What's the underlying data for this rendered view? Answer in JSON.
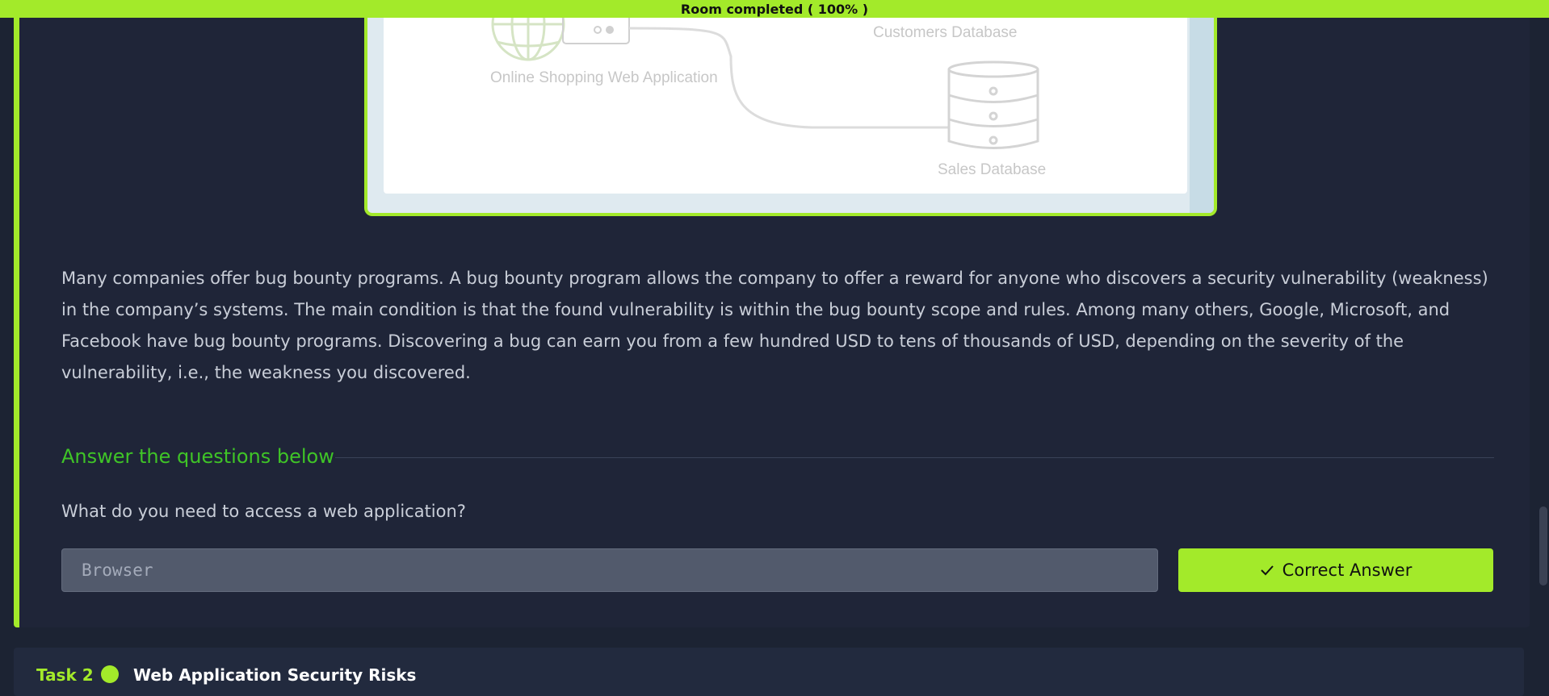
{
  "progress": {
    "label": "Room completed ( 100% )",
    "percent": 100
  },
  "diagram": {
    "web_app_label": "Online Shopping Web Application",
    "customers_db_label": "Customers Database",
    "sales_db_label": "Sales Database"
  },
  "content": {
    "paragraph": "Many companies offer bug bounty programs. A bug bounty program allows the company to offer a reward for anyone who discovers a security vulnerability (weakness) in the company’s systems. The main condition is that the found vulnerability is within the bug bounty scope and rules. Among many others, Google, Microsoft, and Facebook have bug bounty programs. Discovering a bug can earn you from a few hundred USD to tens of thousands of USD, depending on the severity of the vulnerability, i.e., the weakness you discovered."
  },
  "questions": {
    "heading": "Answer the questions below",
    "items": [
      {
        "text": "What do you need to access a web application?",
        "answer": "Browser",
        "button_label": "Correct Answer",
        "button_icon": "checkmark-icon"
      }
    ]
  },
  "next_task": {
    "label": "Task 2",
    "title": "Web Application Security Risks"
  },
  "colors": {
    "accent": "#a3ea2a",
    "heading_green": "#3fc427",
    "background": "#1c2333",
    "card": "#1f2538"
  }
}
